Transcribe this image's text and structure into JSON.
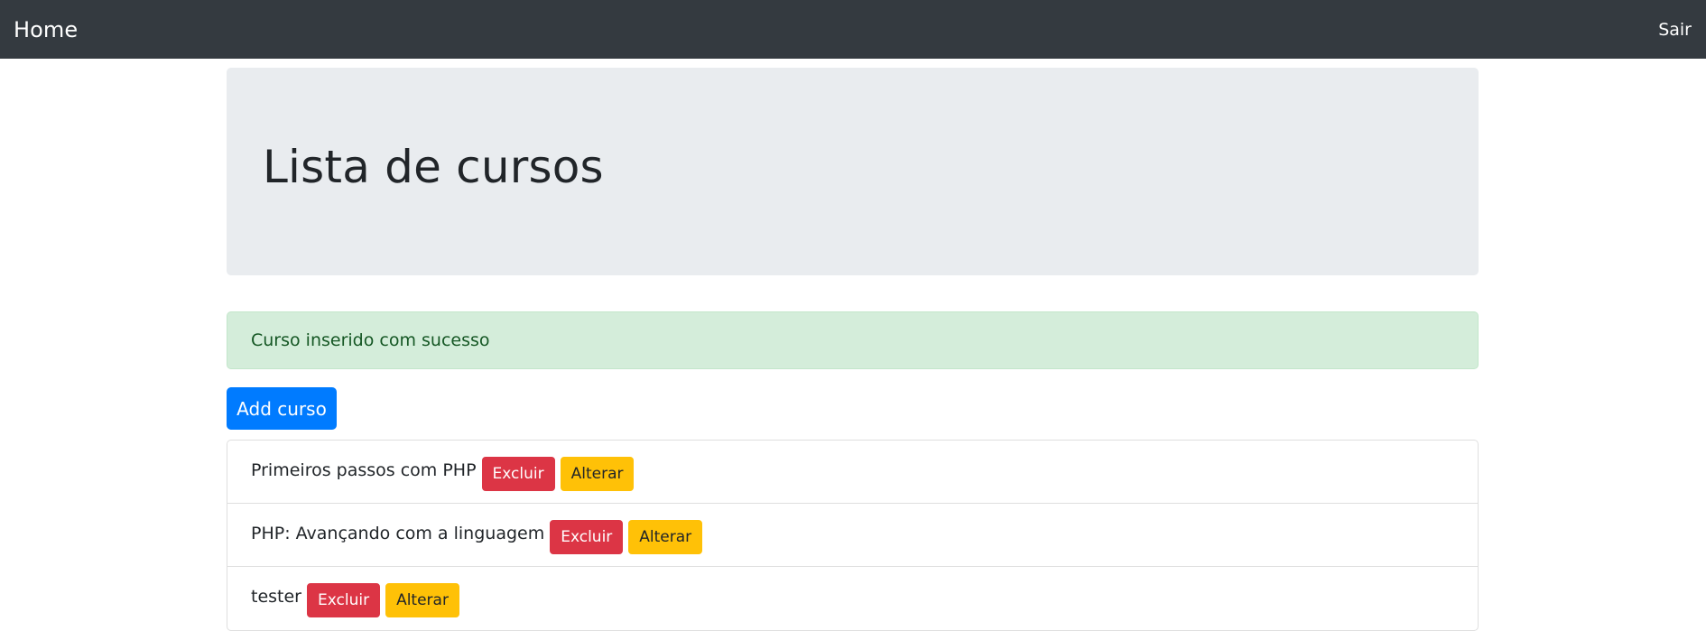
{
  "navbar": {
    "brand": "Home",
    "logout": "Sair",
    "background": "#343a40"
  },
  "jumbotron": {
    "title": "Lista de cursos"
  },
  "alert": {
    "message": "Curso inserido com sucesso",
    "type": "success"
  },
  "actions": {
    "add_label": "Add curso"
  },
  "courses": [
    {
      "name": "Primeiros passos com PHP",
      "delete_label": "Excluir",
      "edit_label": "Alterar"
    },
    {
      "name": "PHP: Avançando com a linguagem",
      "delete_label": "Excluir",
      "edit_label": "Alterar"
    },
    {
      "name": "tester",
      "delete_label": "Excluir",
      "edit_label": "Alterar"
    }
  ],
  "colors": {
    "primary": "#007bff",
    "danger": "#dc3545",
    "warning": "#ffc107",
    "alert_bg": "#d4edda",
    "jumbotron_bg": "#e9ecef"
  }
}
